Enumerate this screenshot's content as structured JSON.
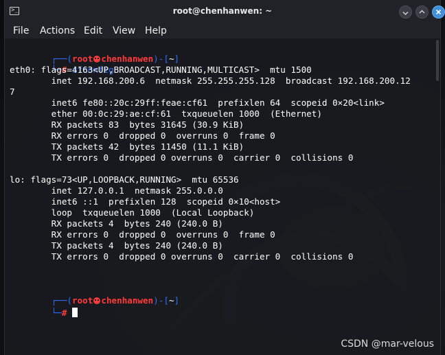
{
  "window": {
    "title": "root@chenhanwen: ~",
    "icon": "terminal-icon",
    "buttons": [
      "minimize-icon",
      "maximize-icon",
      "close-icon"
    ],
    "accent": "#3f8fd9"
  },
  "menu": {
    "file": "File",
    "actions": "Actions",
    "edit": "Edit",
    "view": "View",
    "help": "Help"
  },
  "prompt": {
    "open_bracket": "(",
    "user": "root",
    "host": "chenhanwen",
    "sep": ")-[",
    "dir": "~",
    "close_bracket": "]",
    "corner_top": "┌──",
    "corner_bottom": "└─",
    "symbol": "#",
    "user_color": "#ff3b3b",
    "frame_color": "#2f6df6"
  },
  "command": "ifconfig",
  "output": [
    "eth0: flags=4163<UP,BROADCAST,RUNNING,MULTICAST>  mtu 1500",
    "        inet 192.168.200.6  netmask 255.255.255.128  broadcast 192.168.200.12",
    "7",
    "        inet6 fe80::20c:29ff:feae:cf61  prefixlen 64  scopeid 0×20<link>",
    "        ether 00:0c:29:ae:cf:61  txqueuelen 1000  (Ethernet)",
    "        RX packets 83  bytes 31645 (30.9 KiB)",
    "        RX errors 0  dropped 0  overruns 0  frame 0",
    "        TX packets 42  bytes 11450 (11.1 KiB)",
    "        TX errors 0  dropped 0 overruns 0  carrier 0  collisions 0",
    "",
    "lo: flags=73<UP,LOOPBACK,RUNNING>  mtu 65536",
    "        inet 127.0.0.1  netmask 255.0.0.0",
    "        inet6 ::1  prefixlen 128  scopeid 0×10<host>",
    "        loop  txqueuelen 1000  (Local Loopback)",
    "        RX packets 4  bytes 240 (240.0 B)",
    "        RX errors 0  dropped 0  overruns 0  frame 0",
    "        TX packets 4  bytes 240 (240.0 B)",
    "        TX errors 0  dropped 0 overruns 0  carrier 0  collisions 0"
  ],
  "watermark": "CSDN @mar-velous"
}
